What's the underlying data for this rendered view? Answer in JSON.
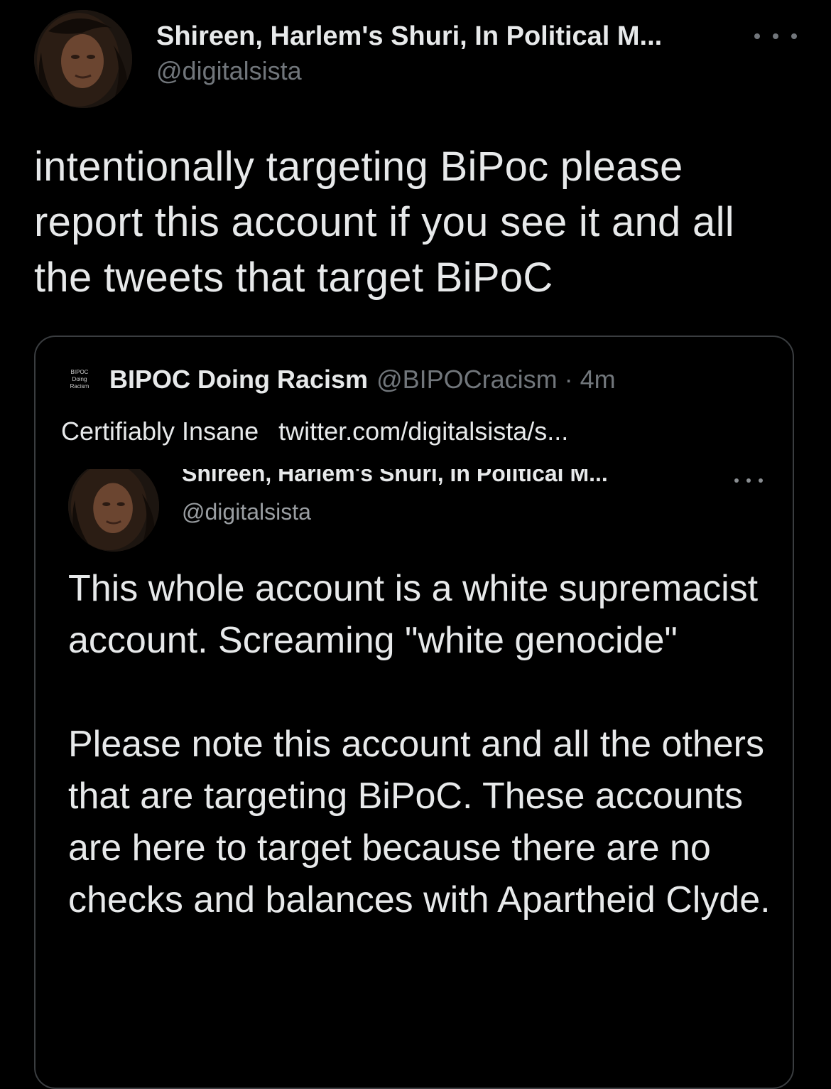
{
  "tweet": {
    "display_name": "Shireen, Harlem's Shuri, In Political M...",
    "handle": "@digitalsista",
    "more_icon": "more-horizontal-icon",
    "text": "intentionally targeting BiPoc please report this account if you see it and all the tweets that target BiPoC"
  },
  "quote": {
    "logo_lines": [
      "BIPOC",
      "Doing",
      "Racism"
    ],
    "display_name": "BIPOC Doing Racism",
    "handle": "@BIPOCracism",
    "separator": "·",
    "time": "4m",
    "text": "Certifiably Insane",
    "link": "twitter.com/digitalsista/s...",
    "embedded": {
      "display_name": "Shireen, Harlem's Shuri, In Political M...",
      "handle": "@digitalsista",
      "text": "This whole account is a white supremacist account. Screaming \"white genocide\"\n\nPlease note this account and all the others that are targeting BiPoC. These accounts are here to target because there are no checks and balances with Apartheid Clyde."
    }
  }
}
